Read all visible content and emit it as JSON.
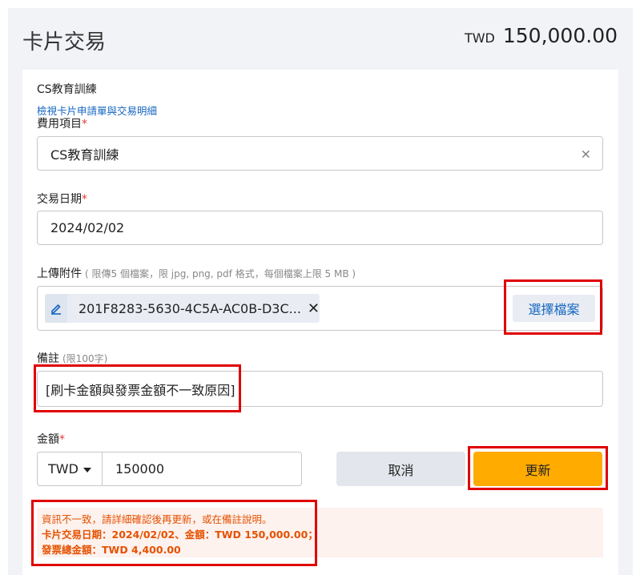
{
  "header": {
    "title": "卡片交易",
    "currency": "TWD",
    "amount": "150,000.00"
  },
  "card": {
    "name": "CS教育訓練",
    "link": "檢視卡片申請單與交易明細"
  },
  "form": {
    "expense_item": {
      "label": "費用項目",
      "required_mark": "*",
      "value": "CS教育訓練",
      "clear": "×"
    },
    "transaction_date": {
      "label": "交易日期",
      "required_mark": "*",
      "value": "2024/02/02"
    },
    "attachments": {
      "label": "上傳附件",
      "hint": "( 限傳5 個檔案，限 jpg, png, pdf 格式，每個檔案上限 5 MB )",
      "file_name": "201F8283-5630-4C5A-AC0B-D3C...",
      "remove": "✕",
      "choose_button": "選擇檔案"
    },
    "remark": {
      "label": "備註",
      "hint": "(限100字)",
      "value": "[刷卡金額與發票金額不一致原因]"
    },
    "amount": {
      "label": "金額",
      "required_mark": "*",
      "currency": "TWD",
      "value": "150000"
    }
  },
  "buttons": {
    "cancel": "取消",
    "update": "更新"
  },
  "warning": {
    "line1": "資訊不一致，請詳細確認後再更新，或在備註說明。",
    "line2": "卡片交易日期：2024/02/02、金額：TWD 150,000.00；",
    "line3": "發票總金額：TWD 4,400.00"
  },
  "colors": {
    "accent": "#1565c0",
    "primary_button": "#ffab00",
    "warning_text": "#e65100",
    "highlight_box": "#e00000"
  }
}
